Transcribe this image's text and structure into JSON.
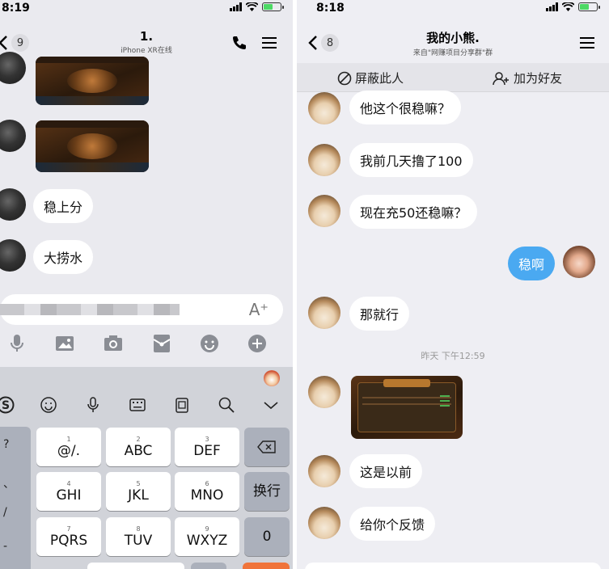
{
  "left_screen": {
    "status": {
      "time": "8:19"
    },
    "header": {
      "back_count": "9",
      "title": "1.",
      "subtitle": "iPhone XR在线"
    },
    "messages": [
      {
        "type": "image"
      },
      {
        "type": "image"
      },
      {
        "type": "text",
        "text": "稳上分"
      },
      {
        "type": "text",
        "text": "大捞水"
      }
    ],
    "input": {
      "font_icon": "A⁺"
    },
    "toolbar_icons": [
      "mic-icon",
      "photo-icon",
      "camera-icon",
      "red-packet-icon",
      "emoji-icon",
      "plus-icon"
    ],
    "keyboard": {
      "top_icons": [
        "sogou-icon",
        "emoji-icon",
        "mic-icon",
        "keyboard-icon",
        "clipboard-icon",
        "search-icon",
        "collapse-icon"
      ],
      "side_keys": [
        "?",
        "、",
        "/",
        "-"
      ],
      "rows": [
        [
          {
            "num": "1",
            "label": "@/."
          },
          {
            "num": "2",
            "label": "ABC"
          },
          {
            "num": "3",
            "label": "DEF"
          }
        ],
        [
          {
            "num": "4",
            "label": "GHI"
          },
          {
            "num": "5",
            "label": "JKL"
          },
          {
            "num": "6",
            "label": "MNO"
          }
        ],
        [
          {
            "num": "7",
            "label": "PQRS"
          },
          {
            "num": "8",
            "label": "TUV"
          },
          {
            "num": "9",
            "label": "WXYZ"
          }
        ]
      ],
      "right_keys": {
        "enter": "换行",
        "zero": "0"
      }
    }
  },
  "right_screen": {
    "status": {
      "time": "8:18"
    },
    "header": {
      "back_count": "8",
      "title": "我的小熊.",
      "subtitle": "来自\"网赚项目分享群\"群"
    },
    "actions": {
      "block": "屏蔽此人",
      "add_friend": "加为好友"
    },
    "messages": [
      {
        "side": "left",
        "text": "他这个很稳嘛？"
      },
      {
        "side": "left",
        "text": "我前几天撸了100"
      },
      {
        "side": "left",
        "text": "现在充50还稳嘛？"
      },
      {
        "side": "right",
        "text": "稳啊"
      },
      {
        "side": "left",
        "text": "那就行"
      },
      {
        "side": "left",
        "type": "image"
      },
      {
        "side": "left",
        "text": "这是以前"
      },
      {
        "side": "left",
        "text": "给你个反馈"
      }
    ],
    "timestamp": "昨天 下午12:59"
  },
  "colors": {
    "bubble_me": "#4aa9f1",
    "bubble_other": "#ffffff",
    "chat_bg": "#eeeef3",
    "battery": "#4cd964"
  }
}
